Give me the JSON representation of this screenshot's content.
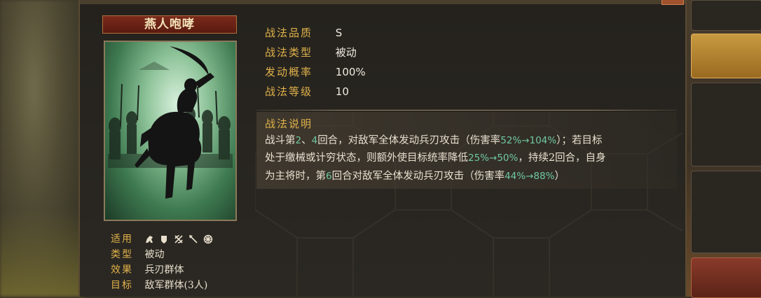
{
  "card": {
    "name": "燕人咆哮"
  },
  "attributes": [
    {
      "key": "适用",
      "icons": [
        "cavalry-icon",
        "shield-icon",
        "crossed-bows-icon",
        "spear-icon",
        "wheel-icon"
      ]
    },
    {
      "key": "类型",
      "value": "被动"
    },
    {
      "key": "效果",
      "value": "兵刃群体"
    },
    {
      "key": "目标",
      "value": "敌军群体(3人)"
    }
  ],
  "info": [
    {
      "key": "战法品质",
      "value": "S"
    },
    {
      "key": "战法类型",
      "value": "被动"
    },
    {
      "key": "发动概率",
      "value": "100%"
    },
    {
      "key": "战法等级",
      "value": "10"
    }
  ],
  "description": {
    "title": "战法说明",
    "line1": {
      "t1": "战斗第",
      "n1": "2",
      "t2": "、",
      "n2": "4",
      "t3": "回合，对敌军全体发动兵刃攻击（伤害率",
      "h1": "52%→104%",
      "t4": "）；若目标"
    },
    "line2": {
      "t1": "处于缴械或计穷状态，则额外使目标统率降低",
      "h1": "25%→50%",
      "t2": "，持续2回合，自身"
    },
    "line3": {
      "t1": "为主将时，第",
      "n1": "6",
      "t2": "回合对敌军全体发动兵刃攻击（伤害率",
      "h1": "44%→88%",
      "t3": "）"
    }
  },
  "colors": {
    "label_gold": "#e0b24a",
    "highlight_green": "#6fc8a0",
    "text_light": "#e8e0cf",
    "name_banner": "#7a2a1a"
  }
}
